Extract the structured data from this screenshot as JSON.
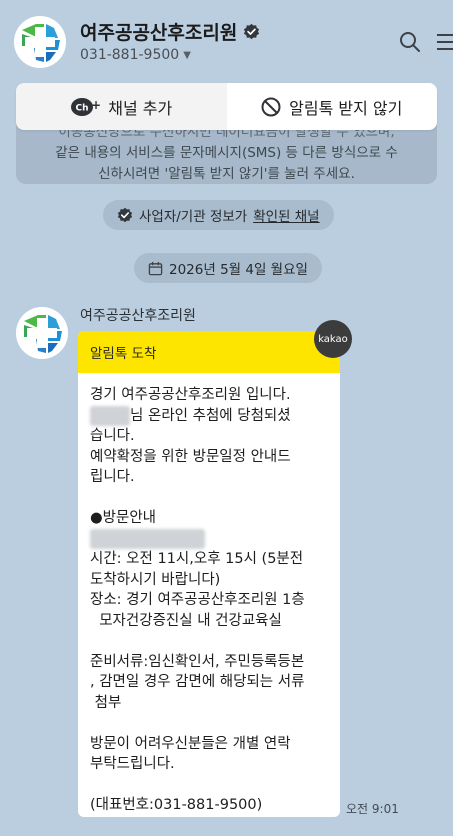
{
  "header": {
    "channel_name": "여주공공산후조리원",
    "phone": "031-881-9500"
  },
  "actions": {
    "add_channel": "채널 추가",
    "block_alimtalk": "알림톡 받지 않기"
  },
  "notice": {
    "line1": "이동통신망으로 수신하시면 데이터요금이 발생할 수 있으며,",
    "line2": "같은 내용의 서비스를 문자메시지(SMS) 등 다른 방식으로 수",
    "line3": "신하시려면 '알림톡 받지 않기'를 눌러 주세요."
  },
  "business_info": {
    "label": "사업자/기관 정보가",
    "link": "확인된 채널"
  },
  "date_divider": "2026년 5월 4일 월요일",
  "message": {
    "sender": "여주공공산후조리원",
    "header_label": "알림톡 도착",
    "badge": "kakao",
    "line1": "경기 여주공공산후조리원 입니다.",
    "line2_suffix": "님 온라인 추첨에 당첨되셨",
    "line3": "습니다.",
    "line4": "예약확정을 위한 방문일정 안내드",
    "line5": "립니다.",
    "visit_title": "●방문안내",
    "time_line1": "시간:  오전 11시,오후 15시 (5분전",
    "time_line2": "도착하시기 바랍니다)",
    "place_line1": "장소: 경기 여주공공산후조리원 1층",
    "place_line2": "  모자건강증진실 내 건강교육실",
    "docs_line1": "준비서류:임신확인서, 주민등록등본",
    "docs_line2": ", 감면일 경우 감면에 해당되는 서류",
    "docs_line3": " 첨부",
    "contact_line1": "방문이 어려우신분들은 개별 연락",
    "contact_line2": "부탁드립니다.",
    "rep_number": "(대표번호:031-881-9500)",
    "time": "오전 9:01"
  },
  "colors": {
    "background": "#bacee0",
    "alimtalk_header": "#fee500",
    "logo_green": "#4cb848",
    "logo_blue": "#1f8fd6"
  }
}
